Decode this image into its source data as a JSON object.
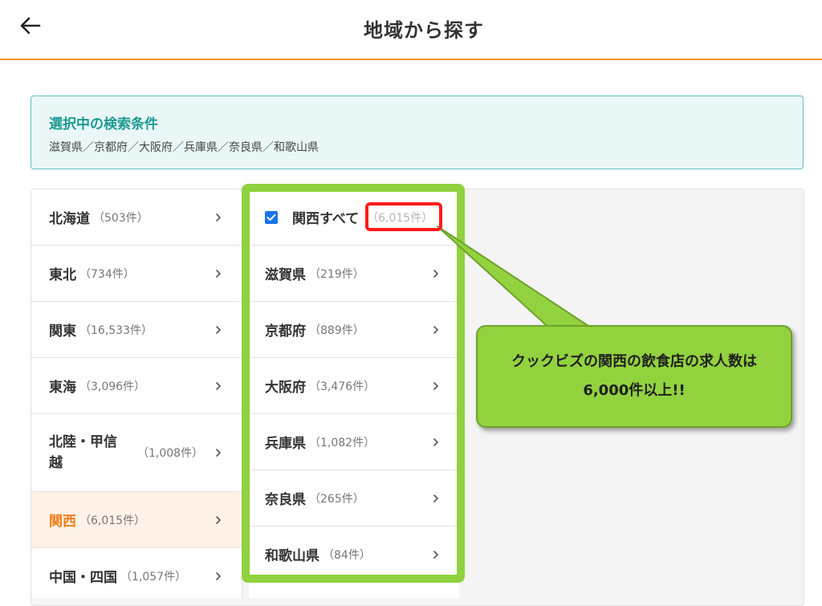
{
  "header": {
    "title": "地域から探す",
    "back_icon": "arrow-left-icon"
  },
  "conditions": {
    "heading": "選択中の検索条件",
    "value": "滋賀県／京都府／大阪府／兵庫県／奈良県／和歌山県"
  },
  "regions": [
    {
      "name": "北海道",
      "count": "（503件）"
    },
    {
      "name": "東北",
      "count": "（734件）"
    },
    {
      "name": "関東",
      "count": "（16,533件）"
    },
    {
      "name": "東海",
      "count": "（3,096件）"
    },
    {
      "name_line1": "北陸・甲信",
      "name_line2": "越",
      "count": "（1,008件）"
    },
    {
      "name": "関西",
      "count": "（6,015件）",
      "active": true
    },
    {
      "name": "中国・四国",
      "count": "（1,057件）"
    }
  ],
  "prefectures": {
    "all": {
      "label": "関西すべて",
      "count": "（6,015件）",
      "checked": true
    },
    "items": [
      {
        "name": "滋賀県",
        "count": "（219件）"
      },
      {
        "name": "京都府",
        "count": "（889件）"
      },
      {
        "name": "大阪府",
        "count": "（3,476件）"
      },
      {
        "name": "兵庫県",
        "count": "（1,082件）"
      },
      {
        "name": "奈良県",
        "count": "（265件）"
      },
      {
        "name": "和歌山県",
        "count": "（84件）"
      }
    ]
  },
  "callout": {
    "line1": "クックビズの関西の飲食店の求人数は",
    "line2": "6,000件以上!!"
  },
  "colors": {
    "accent_orange": "#f07d1a",
    "teal": "#1e9a93",
    "highlight_green": "#8fd13e",
    "highlight_red": "#ff1a1a",
    "checkbox_blue": "#1a73e8"
  }
}
